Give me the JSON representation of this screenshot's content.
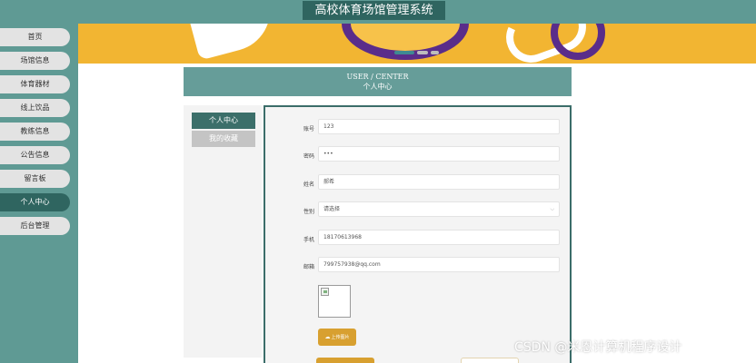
{
  "app": {
    "title": "高校体育场馆管理系统"
  },
  "sidebar": {
    "items": [
      {
        "label": "首页",
        "active": false
      },
      {
        "label": "场馆信息",
        "active": false
      },
      {
        "label": "体育器材",
        "active": false
      },
      {
        "label": "线上饮品",
        "active": false
      },
      {
        "label": "教练信息",
        "active": false
      },
      {
        "label": "公告信息",
        "active": false
      },
      {
        "label": "留言板",
        "active": false
      },
      {
        "label": "个人中心",
        "active": true
      },
      {
        "label": "后台管理",
        "active": false
      }
    ]
  },
  "banner": {
    "slide_count": 3,
    "active_slide": 1
  },
  "page_header": {
    "title_en": "USER / CENTER",
    "title_cn": "个人中心"
  },
  "side_menu": {
    "items": [
      {
        "label": "个人中心",
        "active": true
      },
      {
        "label": "我的收藏",
        "active": false
      }
    ]
  },
  "form": {
    "fields": {
      "account": {
        "label": "账号",
        "value": "123"
      },
      "password": {
        "label": "密码",
        "value": "•••"
      },
      "name": {
        "label": "姓名",
        "value": "郝希"
      },
      "gender": {
        "label": "性别",
        "value": "请选择"
      },
      "phone": {
        "label": "手机",
        "value": "18170613968"
      },
      "email": {
        "label": "邮箱",
        "value": "799757938@qq.com"
      }
    },
    "upload_label": "上传图片"
  },
  "watermark": "CSDN @米恩计算机程序设计",
  "colors": {
    "teal": "#5f9a94",
    "dark_teal": "#2f6560",
    "banner_gold": "#f2b532",
    "button_gold": "#d8a030"
  }
}
